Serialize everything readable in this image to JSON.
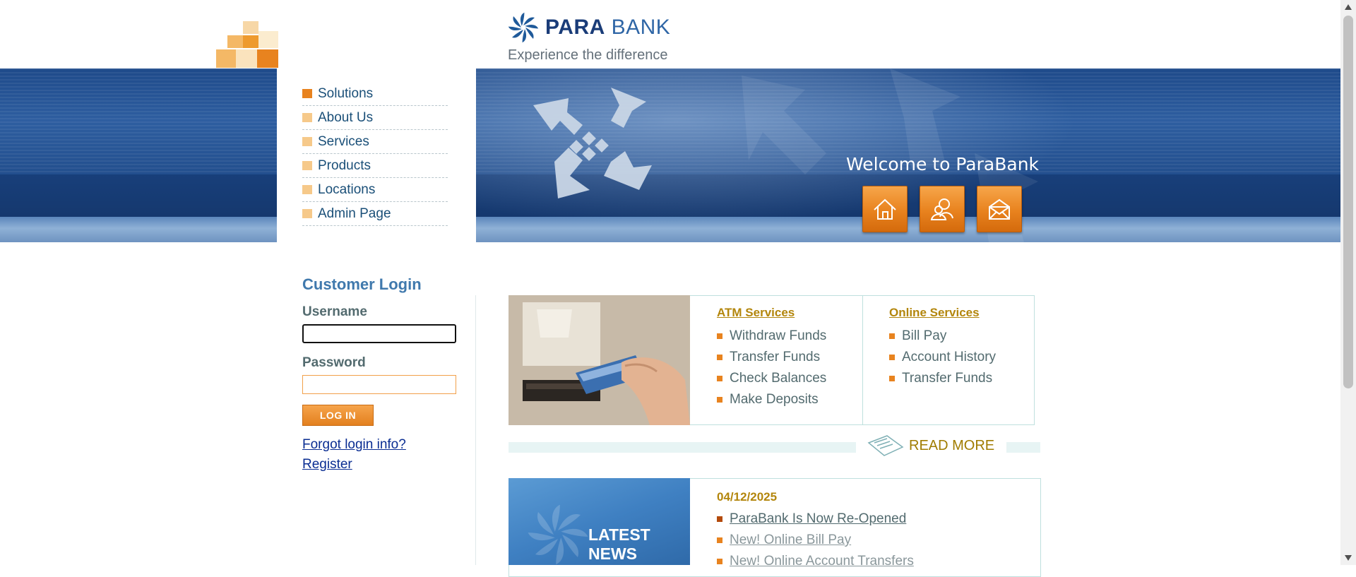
{
  "header": {
    "brand_para": "PARA",
    "brand_bank": "BANK",
    "tagline": "Experience the difference"
  },
  "banner": {
    "welcome": "Welcome to ParaBank"
  },
  "quick_links": [
    {
      "icon": "home-icon"
    },
    {
      "icon": "about-icon"
    },
    {
      "icon": "contact-icon"
    }
  ],
  "left_menu": [
    {
      "label": "Solutions"
    },
    {
      "label": "About Us"
    },
    {
      "label": "Services"
    },
    {
      "label": "Products"
    },
    {
      "label": "Locations"
    },
    {
      "label": "Admin Page"
    }
  ],
  "login": {
    "title": "Customer Login",
    "username_label": "Username",
    "password_label": "Password",
    "username_value": "",
    "password_value": "",
    "button": "LOG IN",
    "forgot": "Forgot login info?",
    "register": "Register"
  },
  "services": {
    "atm": {
      "heading": "ATM Services",
      "items": [
        "Withdraw Funds",
        "Transfer Funds",
        "Check Balances",
        "Make Deposits"
      ]
    },
    "online": {
      "heading": "Online Services",
      "items": [
        "Bill Pay",
        "Account History",
        "Transfer Funds"
      ]
    },
    "read_more": "READ MORE"
  },
  "news": {
    "photo_text_line1": "LATEST",
    "photo_text_line2": "NEWS",
    "date": "04/12/2025",
    "items": [
      "ParaBank Is Now Re-Opened",
      "New! Online Bill Pay",
      "New! Online Account Transfers"
    ]
  },
  "colors": {
    "accent_orange": "#e8831f",
    "brand_blue": "#1a3c78",
    "banner_blue": "#1e4a8a"
  }
}
